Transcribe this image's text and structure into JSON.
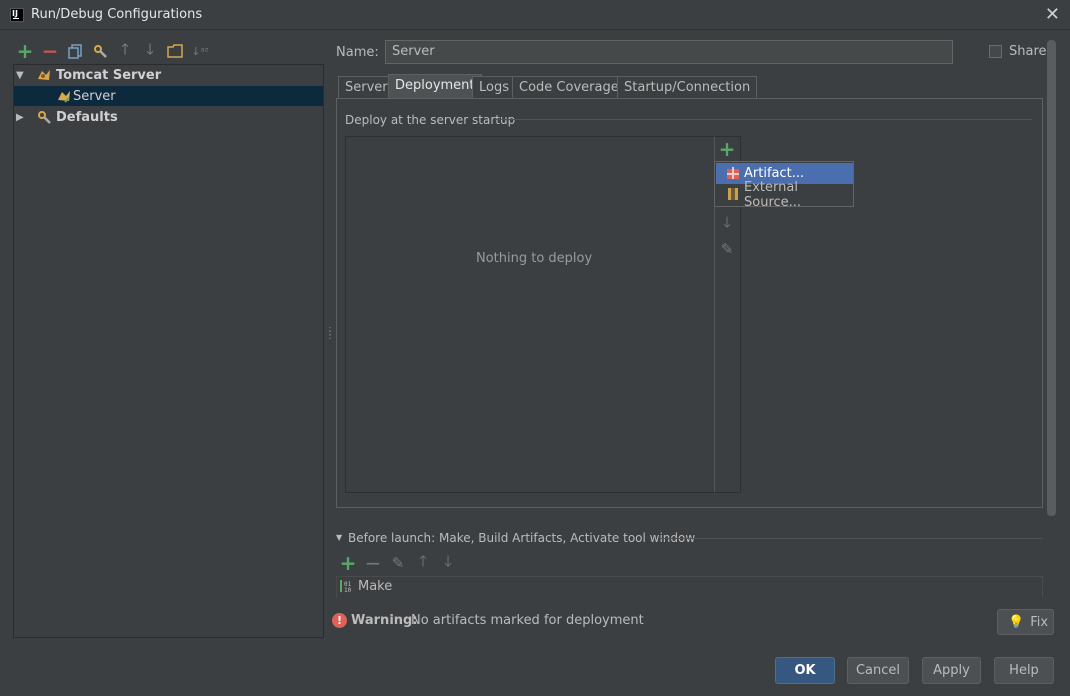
{
  "window": {
    "title": "Run/Debug Configurations",
    "app_icon_text": "IJ"
  },
  "left_toolbar": {
    "icons": [
      "add-icon",
      "remove-icon",
      "copy-icon",
      "edit-defaults-icon",
      "move-up-icon",
      "move-down-icon",
      "folder-icon",
      "sort-icon"
    ]
  },
  "tree": {
    "items": [
      {
        "label": "Tomcat Server",
        "bold": true,
        "expanded": true
      },
      {
        "label": "Server",
        "selected": true
      },
      {
        "label": "Defaults",
        "bold": true,
        "expanded": false
      }
    ]
  },
  "form": {
    "name_label": "Name:",
    "name_value": "Server",
    "share_label": "Share"
  },
  "tabs": [
    {
      "label": "Server",
      "active": false
    },
    {
      "label": "Deployment",
      "active": true
    },
    {
      "label": "Logs",
      "active": false
    },
    {
      "label": "Code Coverage",
      "active": false
    },
    {
      "label": "Startup/Connection",
      "active": false
    }
  ],
  "deployment": {
    "header": "Deploy at the server startup",
    "empty_text": "Nothing to deploy",
    "popup_items": [
      {
        "label": "Artifact...",
        "highlighted": true,
        "icon": "artifact-icon"
      },
      {
        "label": "External Source...",
        "highlighted": false,
        "icon": "external-source-icon"
      }
    ]
  },
  "before_launch": {
    "label": "Before launch: Make, Build Artifacts, Activate tool window",
    "items": [
      "Make"
    ]
  },
  "warning": {
    "strong": "Warning:",
    "text": "No artifacts marked for deployment",
    "fix_label": "Fix"
  },
  "buttons": {
    "ok": "OK",
    "cancel": "Cancel",
    "apply": "Apply",
    "help": "Help"
  },
  "colors": {
    "background": "#3c3f41",
    "selection": "#0d293e",
    "popup_highlight": "#4b6eaf",
    "add_green": "#59a869",
    "remove_red": "#c75450",
    "default_button": "#365880"
  }
}
